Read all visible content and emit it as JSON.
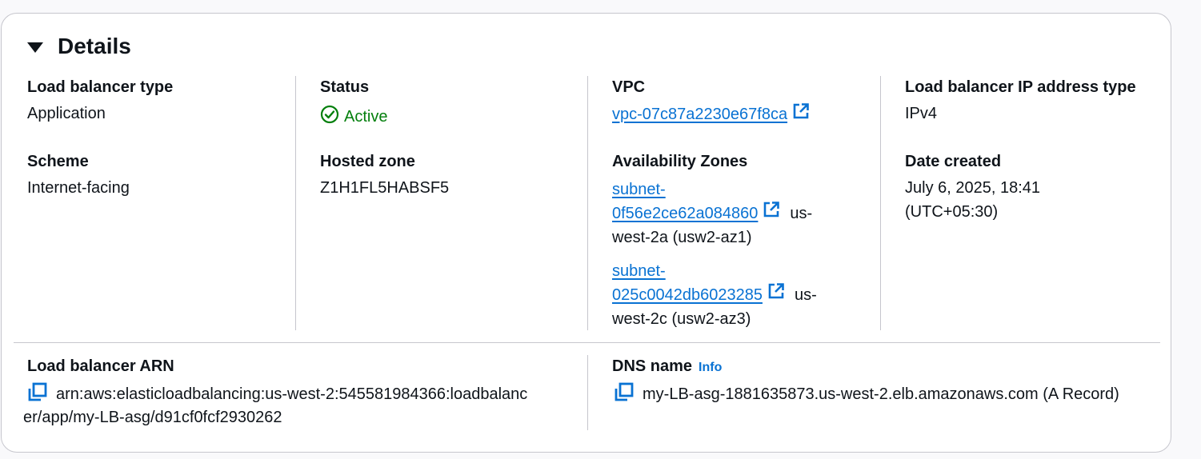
{
  "section": {
    "title": "Details"
  },
  "load_balancer_type": {
    "label": "Load balancer type",
    "value": "Application"
  },
  "status": {
    "label": "Status",
    "value": "Active",
    "icon": "check-circle-icon",
    "color": "#037f0c"
  },
  "vpc": {
    "label": "VPC",
    "value": "vpc-07c87a2230e67f8ca",
    "icon": "external-link-icon"
  },
  "ip_address_type": {
    "label": "Load balancer IP address type",
    "value": "IPv4"
  },
  "scheme": {
    "label": "Scheme",
    "value": "Internet-facing"
  },
  "hosted_zone": {
    "label": "Hosted zone",
    "value": "Z1H1FL5HABSF5"
  },
  "availability_zones": {
    "label": "Availability Zones",
    "items": [
      {
        "subnet_line1": "subnet-",
        "subnet_line2": "0f56e2ce62a084860",
        "suffix": "us-",
        "zone": "west-2a (usw2-az1)"
      },
      {
        "subnet_line1": "subnet-",
        "subnet_line2": "025c0042db6023285",
        "suffix": "us-",
        "zone": "west-2c (usw2-az3)"
      }
    ]
  },
  "date_created": {
    "label": "Date created",
    "line1": "July 6, 2025, 18:41",
    "line2": "(UTC+05:30)"
  },
  "arn": {
    "label": "Load balancer ARN",
    "line1": "arn:aws:elasticloadbalancing:us-west-2:545581984366:loadbalanc",
    "line2": "er/app/my-LB-asg/d91cf0fcf2930262",
    "icon": "copy-icon"
  },
  "dns_name": {
    "label": "DNS name",
    "info": "Info",
    "value": "my-LB-asg-1881635873.us-west-2.elb.amazonaws.com (A Record)",
    "icon": "copy-icon"
  },
  "colors": {
    "link": "#0972d3",
    "success": "#037f0c",
    "border": "#c6c6cd",
    "text": "#0f141a"
  }
}
